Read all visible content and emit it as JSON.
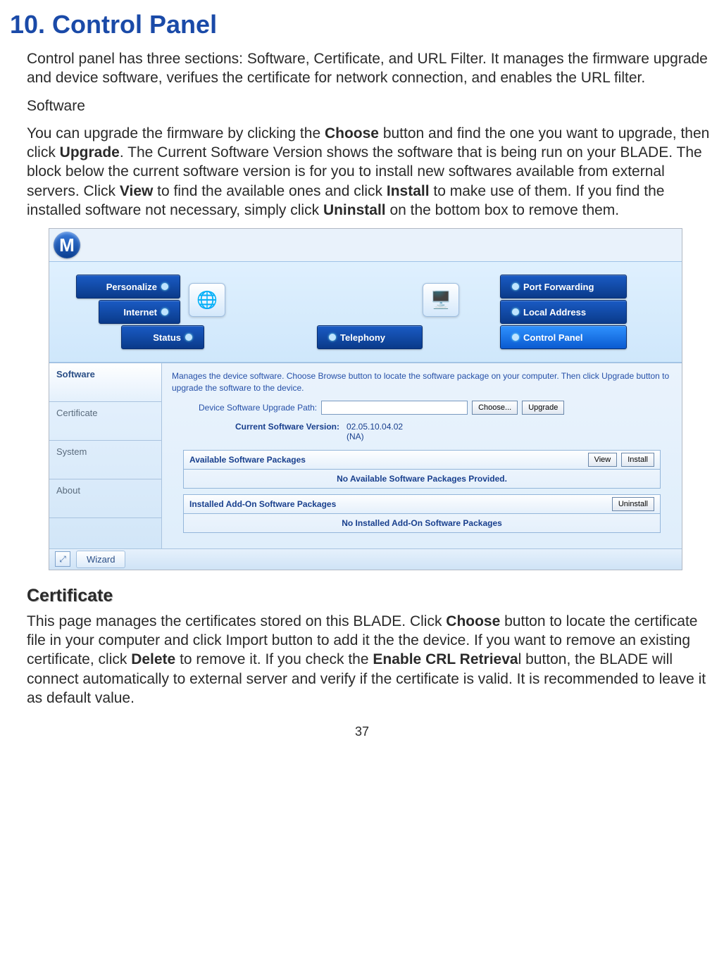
{
  "heading": "10.  Control Panel",
  "p1a": "Control panel has three sections: Software, Certificate, and URL Filter. It manages the firmware upgrade and device software, verifues the certificate for network connection, and enables the URL filter.",
  "p1b": "Software",
  "p2_parts": [
    "You can upgrade the firmware by clicking the ",
    "Choose",
    " button and find the one you want to upgrade, then click ",
    "Upgrade",
    ".    The Current Software Version shows the software that is being run on your BLADE. The block below the current software version is for you to install new softwares available from external servers. Click ",
    "View",
    " to find the available ones and click ",
    "Install",
    " to make use of them. If you find the installed software not necessary, simply click ",
    "Uninstall",
    " on the bottom box to remove them."
  ],
  "shot": {
    "logo_letter": "M",
    "nav": {
      "personalize": "Personalize",
      "internet": "Internet",
      "status": "Status",
      "telephony": "Telephony",
      "port_fwd": "Port Forwarding",
      "local_addr": "Local Address",
      "control_panel": "Control Panel"
    },
    "sidebar": [
      "Software",
      "Certificate",
      "System",
      "About"
    ],
    "help_text": "Manages the device software. Choose Browse button to locate the software package on your computer. Then click Upgrade button to upgrade the software to the device.",
    "upgrade_label": "Device Software Upgrade Path:",
    "choose_btn": "Choose...",
    "upgrade_btn": "Upgrade",
    "curver_label": "Current Software Version:",
    "curver_value": "02.05.10.04.02\n(NA)",
    "avail_title": "Available Software Packages",
    "view_btn": "View",
    "install_btn": "Install",
    "avail_empty": "No Available Software Packages Provided.",
    "inst_title": "Installed Add-On Software Packages",
    "uninstall_btn": "Uninstall",
    "inst_empty": "No Installed Add-On Software Packages",
    "wizard": "Wizard"
  },
  "sub": "Certificate",
  "p3_parts": [
    "This page manages the certificates stored on this BLADE. Click ",
    "Choose",
    " button to locate the certificate file in your computer and click Import button to add it the the device. If you want to remove an existing certificate, click ",
    "Delete",
    " to remove it. If you check the ",
    "Enable CRL Retrieva",
    "l button, the BLADE will connect automatically to external server and verify if the certificate is valid. It is recommended to leave it as default value."
  ],
  "page_num": "37"
}
